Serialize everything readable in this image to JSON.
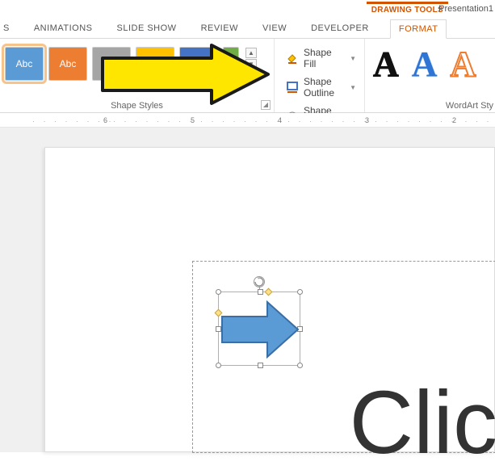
{
  "top": {
    "drawing_tools": "DRAWING TOOLS",
    "presentation_name": "Presentation1"
  },
  "tabs": {
    "partial_first": "S",
    "animations": "ANIMATIONS",
    "slideshow": "SLIDE SHOW",
    "review": "REVIEW",
    "view": "VIEW",
    "developer": "DEVELOPER",
    "format": "FORMAT"
  },
  "shape_styles": {
    "swatch_label": "Abc",
    "group_label": "Shape Styles"
  },
  "shape_menu": {
    "fill": "Shape Fill",
    "outline": "Shape Outline",
    "effects": "Shape Effects"
  },
  "wordart": {
    "letter": "A",
    "group_label": "WordArt Sty"
  },
  "ruler": {
    "n6": "6",
    "n5": "5",
    "n4": "4",
    "n3": "3",
    "n2": "2"
  },
  "slide": {
    "big_text_fragment": "Clic"
  }
}
